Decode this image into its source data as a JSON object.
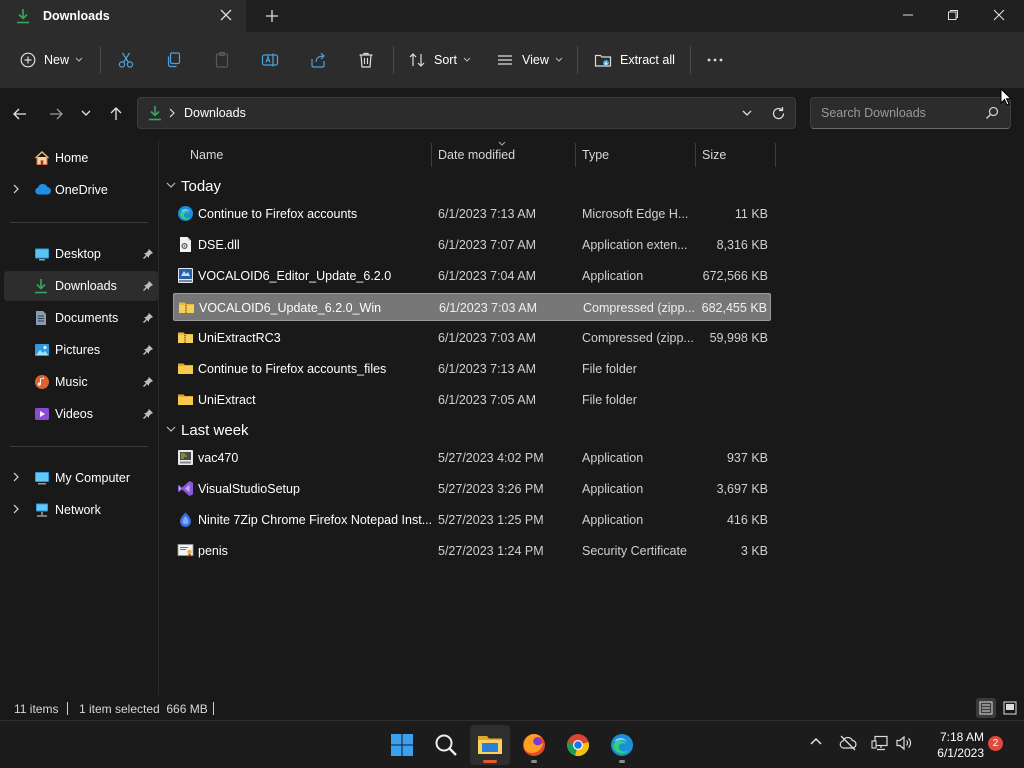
{
  "window": {
    "tab_title": "Downloads",
    "colors": {
      "accent_download": "#3aa55d",
      "selected_row": "#777777"
    }
  },
  "commandbar": {
    "new_label": "New",
    "sort_label": "Sort",
    "view_label": "View",
    "extract_label": "Extract all"
  },
  "address": {
    "breadcrumb": "Downloads",
    "search_placeholder": "Search Downloads"
  },
  "sidebar": {
    "home": "Home",
    "onedrive": "OneDrive",
    "desktop": "Desktop",
    "downloads": "Downloads",
    "documents": "Documents",
    "pictures": "Pictures",
    "music": "Music",
    "videos": "Videos",
    "mycomputer": "My Computer",
    "network": "Network"
  },
  "columns": {
    "name": "Name",
    "date": "Date modified",
    "type": "Type",
    "size": "Size"
  },
  "groups": {
    "today": "Today",
    "lastweek": "Last week"
  },
  "files": [
    {
      "name": "Continue to Firefox accounts",
      "date": "6/1/2023 7:13 AM",
      "type": "Microsoft Edge H...",
      "size": "11 KB",
      "icon": "edge-html-icon"
    },
    {
      "name": "DSE.dll",
      "date": "6/1/2023 7:07 AM",
      "type": "Application exten...",
      "size": "8,316 KB",
      "icon": "dll-file-icon"
    },
    {
      "name": "VOCALOID6_Editor_Update_6.2.0",
      "date": "6/1/2023 7:04 AM",
      "type": "Application",
      "size": "672,566 KB",
      "icon": "installer-icon"
    },
    {
      "name": "VOCALOID6_Update_6.2.0_Win",
      "date": "6/1/2023 7:03 AM",
      "type": "Compressed (zipp...",
      "size": "682,455 KB",
      "icon": "zip-folder-icon"
    },
    {
      "name": "UniExtractRC3",
      "date": "6/1/2023 7:03 AM",
      "type": "Compressed (zipp...",
      "size": "59,998 KB",
      "icon": "zip-folder-icon"
    },
    {
      "name": "Continue to Firefox accounts_files",
      "date": "6/1/2023 7:13 AM",
      "type": "File folder",
      "size": "",
      "icon": "folder-icon"
    },
    {
      "name": "UniExtract",
      "date": "6/1/2023 7:05 AM",
      "type": "File folder",
      "size": "",
      "icon": "folder-icon"
    },
    {
      "name": "vac470",
      "date": "5/27/2023 4:02 PM",
      "type": "Application",
      "size": "937 KB",
      "icon": "app-exe-icon"
    },
    {
      "name": "VisualStudioSetup",
      "date": "5/27/2023 3:26 PM",
      "type": "Application",
      "size": "3,697 KB",
      "icon": "visual-studio-icon"
    },
    {
      "name": "Ninite 7Zip Chrome Firefox Notepad Inst...",
      "date": "5/27/2023 1:25 PM",
      "type": "Application",
      "size": "416 KB",
      "icon": "ninite-icon"
    },
    {
      "name": "penis",
      "date": "5/27/2023 1:24 PM",
      "type": "Security Certificate",
      "size": "3 KB",
      "icon": "certificate-icon"
    }
  ],
  "status": {
    "items": "11 items",
    "selected": "1 item selected  666 MB"
  },
  "taskbar": {
    "time": "7:18 AM",
    "date": "6/1/2023",
    "notifications": "2"
  }
}
